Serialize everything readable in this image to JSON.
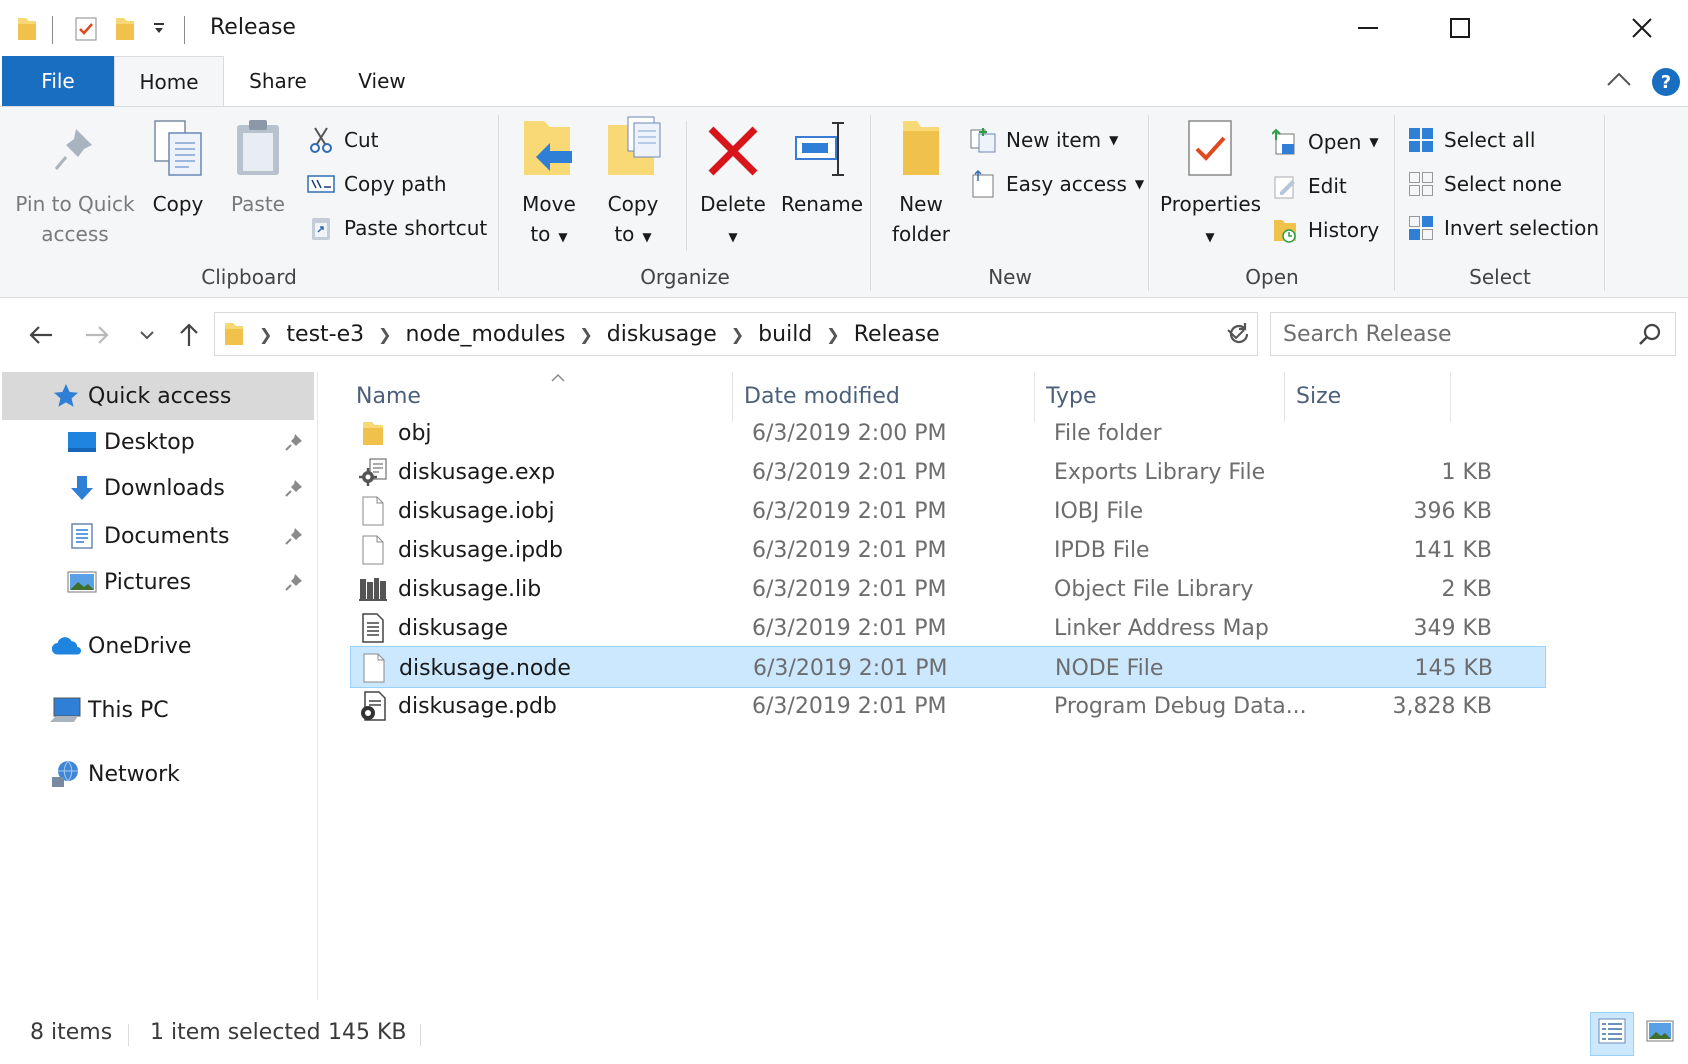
{
  "window": {
    "title": "Release"
  },
  "tabs": {
    "file": "File",
    "home": "Home",
    "share": "Share",
    "view": "View",
    "help": "?"
  },
  "ribbon": {
    "clipboard": {
      "label": "Clipboard",
      "pin_line1": "Pin to Quick",
      "pin_line2": "access",
      "copy": "Copy",
      "paste": "Paste",
      "cut": "Cut",
      "copy_path": "Copy path",
      "paste_shortcut": "Paste shortcut"
    },
    "organize": {
      "label": "Organize",
      "move_line1": "Move",
      "move_line2": "to",
      "copyto_line1": "Copy",
      "copyto_line2": "to",
      "delete": "Delete",
      "rename": "Rename"
    },
    "new": {
      "label": "New",
      "folder_line1": "New",
      "folder_line2": "folder",
      "new_item": "New item",
      "easy_access": "Easy access"
    },
    "open": {
      "label": "Open",
      "properties": "Properties",
      "open": "Open",
      "edit": "Edit",
      "history": "History"
    },
    "select": {
      "label": "Select",
      "select_all": "Select all",
      "select_none": "Select none",
      "invert": "Invert selection"
    }
  },
  "address": {
    "crumbs": [
      "test-e3",
      "node_modules",
      "diskusage",
      "build",
      "Release"
    ],
    "search_placeholder": "Search Release"
  },
  "nav": {
    "quick_access": "Quick access",
    "desktop": "Desktop",
    "downloads": "Downloads",
    "documents": "Documents",
    "pictures": "Pictures",
    "onedrive": "OneDrive",
    "this_pc": "This PC",
    "network": "Network"
  },
  "columns": {
    "name": "Name",
    "date": "Date modified",
    "type": "Type",
    "size": "Size"
  },
  "files": [
    {
      "name": "obj",
      "date": "6/3/2019 2:00 PM",
      "type": "File folder",
      "size": "",
      "icon": "folder-icon"
    },
    {
      "name": "diskusage.exp",
      "date": "6/3/2019 2:01 PM",
      "type": "Exports Library File",
      "size": "1 KB",
      "icon": "gear-file-icon"
    },
    {
      "name": "diskusage.iobj",
      "date": "6/3/2019 2:01 PM",
      "type": "IOBJ File",
      "size": "396 KB",
      "icon": "blank-file-icon"
    },
    {
      "name": "diskusage.ipdb",
      "date": "6/3/2019 2:01 PM",
      "type": "IPDB File",
      "size": "141 KB",
      "icon": "blank-file-icon"
    },
    {
      "name": "diskusage.lib",
      "date": "6/3/2019 2:01 PM",
      "type": "Object File Library",
      "size": "2 KB",
      "icon": "library-file-icon"
    },
    {
      "name": "diskusage",
      "date": "6/3/2019 2:01 PM",
      "type": "Linker Address Map",
      "size": "349 KB",
      "icon": "text-file-icon"
    },
    {
      "name": "diskusage.node",
      "date": "6/3/2019 2:01 PM",
      "type": "NODE File",
      "size": "145 KB",
      "icon": "blank-file-icon"
    },
    {
      "name": "diskusage.pdb",
      "date": "6/3/2019 2:01 PM",
      "type": "Program Debug Data...",
      "size": "3,828 KB",
      "icon": "debug-file-icon"
    }
  ],
  "status": {
    "count": "8 items",
    "selected": "1 item selected",
    "selected_size": "145 KB"
  }
}
